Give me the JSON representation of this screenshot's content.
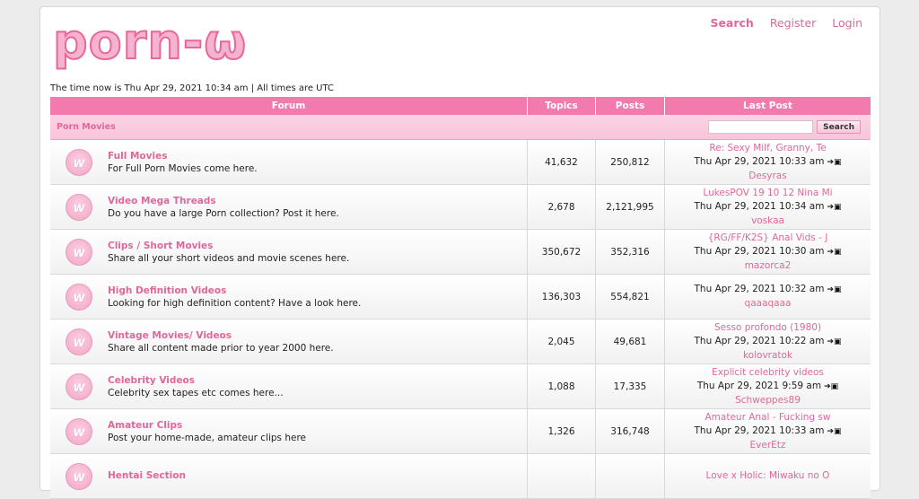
{
  "header": {
    "logo_text": "porn-ω",
    "links": [
      "Search",
      "Register",
      "Login"
    ]
  },
  "time_line": "The time now is Thu Apr 29, 2021 10:34 am | All times are UTC",
  "table": {
    "columns": [
      "Forum",
      "Topics",
      "Posts",
      "Last Post"
    ],
    "category": "Porn Movies",
    "search_button": "Search",
    "rows": [
      {
        "name": "Full Movies",
        "desc": "For Full Porn Movies come here.",
        "topics": "41,632",
        "posts": "250,812",
        "last_topic": "Re: Sexy Milf, Granny, Te",
        "last_date": "Thu Apr 29, 2021 10:33 am",
        "last_user": "Desyras"
      },
      {
        "name": "Video Mega Threads",
        "desc": "Do you have a large Porn collection? Post it here.",
        "topics": "2,678",
        "posts": "2,121,995",
        "last_topic": "LukesPOV 19 10 12 Nina Mi",
        "last_date": "Thu Apr 29, 2021 10:34 am",
        "last_user": "voskaa"
      },
      {
        "name": "Clips / Short Movies",
        "desc": "Share all your short videos and movie scenes here.",
        "topics": "350,672",
        "posts": "352,316",
        "last_topic": "{RG/FF/K2S} Anal Vids - J",
        "last_date": "Thu Apr 29, 2021 10:30 am",
        "last_user": "mazorca2"
      },
      {
        "name": "High Definition Videos",
        "desc": "Looking for high definition content? Have a look here.",
        "topics": "136,303",
        "posts": "554,821",
        "last_topic": "",
        "last_date": "Thu Apr 29, 2021 10:32 am",
        "last_user": "qaaaqaaa"
      },
      {
        "name": "Vintage Movies/ Videos",
        "desc": "Share all content made prior to year 2000 here.",
        "topics": "2,045",
        "posts": "49,681",
        "last_topic": "Sesso profondo (1980)",
        "last_date": "Thu Apr 29, 2021 10:22 am",
        "last_user": "kolovratok"
      },
      {
        "name": "Celebrity Videos",
        "desc": "Celebrity sex tapes etc comes here...",
        "topics": "1,088",
        "posts": "17,335",
        "last_topic": "Explicit celebrity videos",
        "last_date": "Thu Apr 29, 2021 9:59 am",
        "last_user": "Schweppes89"
      },
      {
        "name": "Amateur Clips",
        "desc": "Post your home-made, amateur clips here",
        "topics": "1,326",
        "posts": "316,748",
        "last_topic": "Amateur Anal - Fucking sw",
        "last_date": "Thu Apr 29, 2021 10:33 am",
        "last_user": "EverEtz"
      },
      {
        "name": "Hentai Section",
        "desc": "",
        "topics": "",
        "posts": "",
        "last_topic": "Love x Holic: Miwaku no O",
        "last_date": "",
        "last_user": ""
      }
    ]
  }
}
